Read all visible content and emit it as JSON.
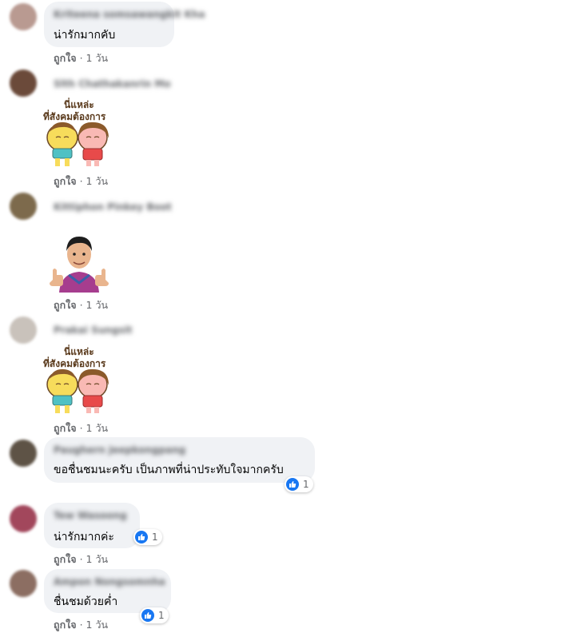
{
  "comments": [
    {
      "author": "Kriteena somsawangkit Kha",
      "text": "น่ารักมากคับ",
      "like_label": "ถูกใจ",
      "separator": "·",
      "time": "1 วัน"
    },
    {
      "author": "Slth Chathakanrin Mo",
      "sticker_line1": "นี่แหล่ะ",
      "sticker_line2": "ที่สังคมต้องการ",
      "like_label": "ถูกใจ",
      "separator": "·",
      "time": "1 วัน"
    },
    {
      "author": "Kittiphon Pinkey Boot",
      "like_label": "ถูกใจ",
      "separator": "·",
      "time": "1 วัน"
    },
    {
      "author": "Prakai Sungsit",
      "sticker_line1": "นี่แหล่ะ",
      "sticker_line2": "ที่สังคมต้องการ",
      "like_label": "ถูกใจ",
      "separator": "·",
      "time": "1 วัน"
    },
    {
      "author": "Paughern Jeepkongpang",
      "text": "ขอชื่นชมนะครับ เป็นภาพที่น่าประทับใจมากครับ",
      "reaction_count": "1"
    },
    {
      "author": "Tew Wasoong",
      "text": "น่ารักมากค่ะ",
      "reaction_count": "1",
      "like_label": "ถูกใจ",
      "separator": "·",
      "time": "1 วัน"
    },
    {
      "author": "Ampon Nongsomnha",
      "text": "ชื่นชมด้วยค่ำ",
      "reaction_count": "1",
      "like_label": "ถูกใจ",
      "separator": "·",
      "time": "1 วัน"
    }
  ],
  "colors": {
    "bubble": "#f0f2f5",
    "meta": "#65676b",
    "like_blue": "#1877f2"
  },
  "icons": {
    "reaction": "thumbs-up-icon"
  }
}
